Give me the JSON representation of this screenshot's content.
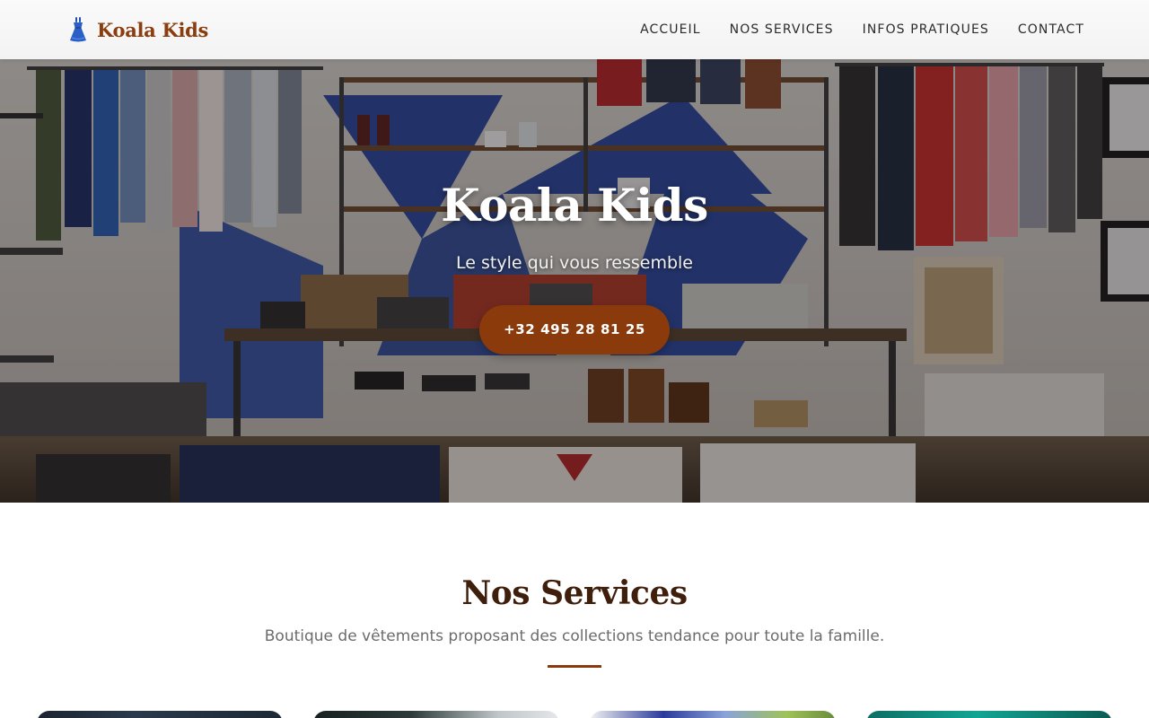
{
  "navbar": {
    "brand_name": "Koala Kids",
    "brand_icon": "dress-icon",
    "links": [
      {
        "label": "ACCUEIL"
      },
      {
        "label": "NOS SERVICES"
      },
      {
        "label": "INFOS PRATIQUES"
      },
      {
        "label": "CONTACT"
      }
    ]
  },
  "hero": {
    "title": "Koala Kids",
    "subtitle": "Le style qui vous ressemble",
    "cta_label": "+32 495 28 81 25",
    "background": "clothing-store-photo"
  },
  "services": {
    "title": "Nos Services",
    "subtitle": "Boutique de vêtements proposant des collections tendance pour toute la famille.",
    "cards": [
      {
        "image": "service-image-1"
      },
      {
        "image": "service-image-2"
      },
      {
        "image": "service-image-3"
      },
      {
        "image": "service-image-4"
      }
    ]
  },
  "colors": {
    "accent": "#8b3b0b",
    "brand_text": "#8a3d0e",
    "heading": "#3f1e0c",
    "muted_text": "#6b6b6b",
    "nav_text": "#2b2b2b",
    "icon_blue": "#2a5fc8"
  }
}
